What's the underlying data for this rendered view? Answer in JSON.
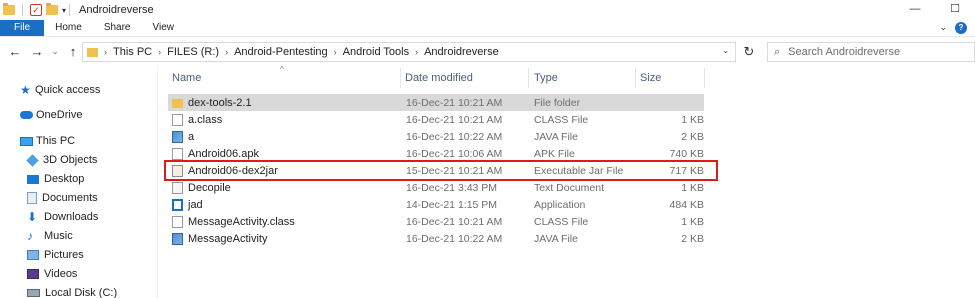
{
  "window": {
    "title": "Androidreverse",
    "minimize_glyph": "—",
    "restore_glyph": "☐"
  },
  "ribbon": {
    "tabs": [
      "File",
      "Home",
      "Share",
      "View"
    ]
  },
  "address": {
    "crumbs": [
      "This PC",
      "FILES (R:)",
      "Android-Pentesting",
      "Android Tools",
      "Androidreverse"
    ],
    "search_placeholder": "Search Androidreverse"
  },
  "nav": {
    "items": [
      {
        "label": "Quick access",
        "icon": "quick-access-star-icon"
      },
      {
        "label": "OneDrive",
        "icon": "onedrive-cloud-icon"
      },
      {
        "label": "This PC",
        "icon": "this-pc-icon"
      },
      {
        "label": "3D Objects",
        "icon": "3d-objects-icon"
      },
      {
        "label": "Desktop",
        "icon": "desktop-icon"
      },
      {
        "label": "Documents",
        "icon": "documents-icon"
      },
      {
        "label": "Downloads",
        "icon": "downloads-icon"
      },
      {
        "label": "Music",
        "icon": "music-icon"
      },
      {
        "label": "Pictures",
        "icon": "pictures-icon"
      },
      {
        "label": "Videos",
        "icon": "videos-icon"
      },
      {
        "label": "Local Disk (C:)",
        "icon": "local-disk-icon"
      }
    ]
  },
  "columns": {
    "name": "Name",
    "date": "Date modified",
    "type": "Type",
    "size": "Size"
  },
  "files": [
    {
      "name": "dex-tools-2.1",
      "date": "16-Dec-21 10:21 AM",
      "type": "File folder",
      "size": "",
      "icon": "folder-icon",
      "selected": true
    },
    {
      "name": "a.class",
      "date": "16-Dec-21 10:21 AM",
      "type": "CLASS File",
      "size": "1 KB",
      "icon": "class-file-icon"
    },
    {
      "name": "a",
      "date": "16-Dec-21 10:22 AM",
      "type": "JAVA File",
      "size": "2 KB",
      "icon": "java-file-icon"
    },
    {
      "name": "Android06.apk",
      "date": "16-Dec-21 10:06 AM",
      "type": "APK File",
      "size": "740 KB",
      "icon": "apk-file-icon"
    },
    {
      "name": "Android06-dex2jar",
      "date": "15-Dec-21 10:21 AM",
      "type": "Executable Jar File",
      "size": "717 KB",
      "icon": "jar-file-icon",
      "highlighted": true
    },
    {
      "name": "Decopile",
      "date": "16-Dec-21 3:43 PM",
      "type": "Text Document",
      "size": "1 KB",
      "icon": "text-document-icon"
    },
    {
      "name": "jad",
      "date": "14-Dec-21 1:15 PM",
      "type": "Application",
      "size": "484 KB",
      "icon": "application-icon"
    },
    {
      "name": "MessageActivity.class",
      "date": "16-Dec-21 10:21 AM",
      "type": "CLASS File",
      "size": "1 KB",
      "icon": "class-file-icon"
    },
    {
      "name": "MessageActivity",
      "date": "16-Dec-21 10:22 AM",
      "type": "JAVA File",
      "size": "2 KB",
      "icon": "java-file-icon"
    }
  ],
  "colors": {
    "accent": "#1a6fc4",
    "highlight_box": "#e01919",
    "selected_row": "#d9d9d9"
  }
}
